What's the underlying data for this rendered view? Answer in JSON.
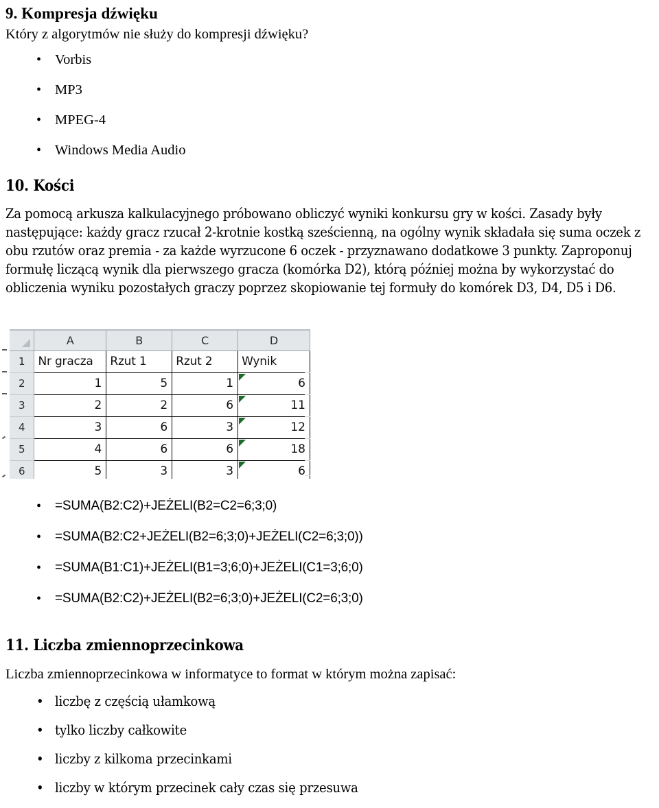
{
  "document": {
    "language": "pl"
  },
  "sections": [
    {
      "number": "9.",
      "title": "9. Kompresja dźwięku",
      "intro": "Który z algorytmów nie służy do kompresji dźwięku?",
      "options": [
        "Vorbis",
        "MP3",
        "MPEG-4",
        "Windows Media Audio"
      ]
    },
    {
      "number": "10.",
      "title": "10. Kości",
      "intro": "Za pomocą arkusza kalkulacyjnego próbowano obliczyć wyniki konkursu gry w kości. Zasady były następujące: każdy gracz rzucał 2-krotnie kostką sześcienną, na ogólny wynik składała się suma oczek z obu rzutów oraz premia - za każde wyrzucone 6 oczek - przyznawano dodatkowe 3 punkty. Zaproponuj formułę liczącą wynik dla pierwszego gracza (komórka D2), którą później można by wykorzystać do obliczenia wyniku pozostałych graczy poprzez skopiowanie tej formuły do komórek D3, D4, D5 i D6.",
      "options": [
        "=SUMA(B2:C2)+JEŻELI(B2=C2=6;3;0)",
        "=SUMA(B2:C2+JEŻELI(B2=6;3;0)+JEŻELI(C2=6;3;0))",
        "=SUMA(B1:C1)+JEŻELI(B1=3;6;0)+JEŻELI(C1=3;6;0)",
        "=SUMA(B2:C2)+JEŻELI(B2=6;3;0)+JEŻELI(C2=6;3;0)"
      ]
    },
    {
      "number": "11.",
      "title": "11. Liczba zmiennoprzecinkowa",
      "intro": "Liczba zmiennoprzecinkowa w informatyce to format w którym można zapisać:",
      "options": [
        "liczbę z częścią ułamkową",
        "tylko liczby całkowite",
        "liczby z kilkoma przecinkami",
        "liczby w którym przecinek cały czas się przesuwa"
      ]
    }
  ],
  "bullet_glyph": "•",
  "spreadsheet": {
    "column_headers": [
      "A",
      "B",
      "C",
      "D"
    ],
    "row_headers": [
      "1",
      "2",
      "3",
      "4",
      "5",
      "6"
    ],
    "header_row": [
      "Nr gracza",
      "Rzut 1",
      "Rzut 2",
      "Wynik"
    ],
    "rows": [
      [
        "1",
        "5",
        "1",
        "6"
      ],
      [
        "2",
        "2",
        "6",
        "11"
      ],
      [
        "3",
        "6",
        "3",
        "12"
      ],
      [
        "4",
        "6",
        "6",
        "18"
      ],
      [
        "5",
        "3",
        "3",
        "6"
      ]
    ],
    "flag_column_index": 3,
    "colors": {
      "header_background": "#e4e7ea",
      "header_text": "#2b2b2b",
      "grid_border": "#000000",
      "flag_marker": "#1f6b2e",
      "cell_background": "#ffffff"
    }
  }
}
